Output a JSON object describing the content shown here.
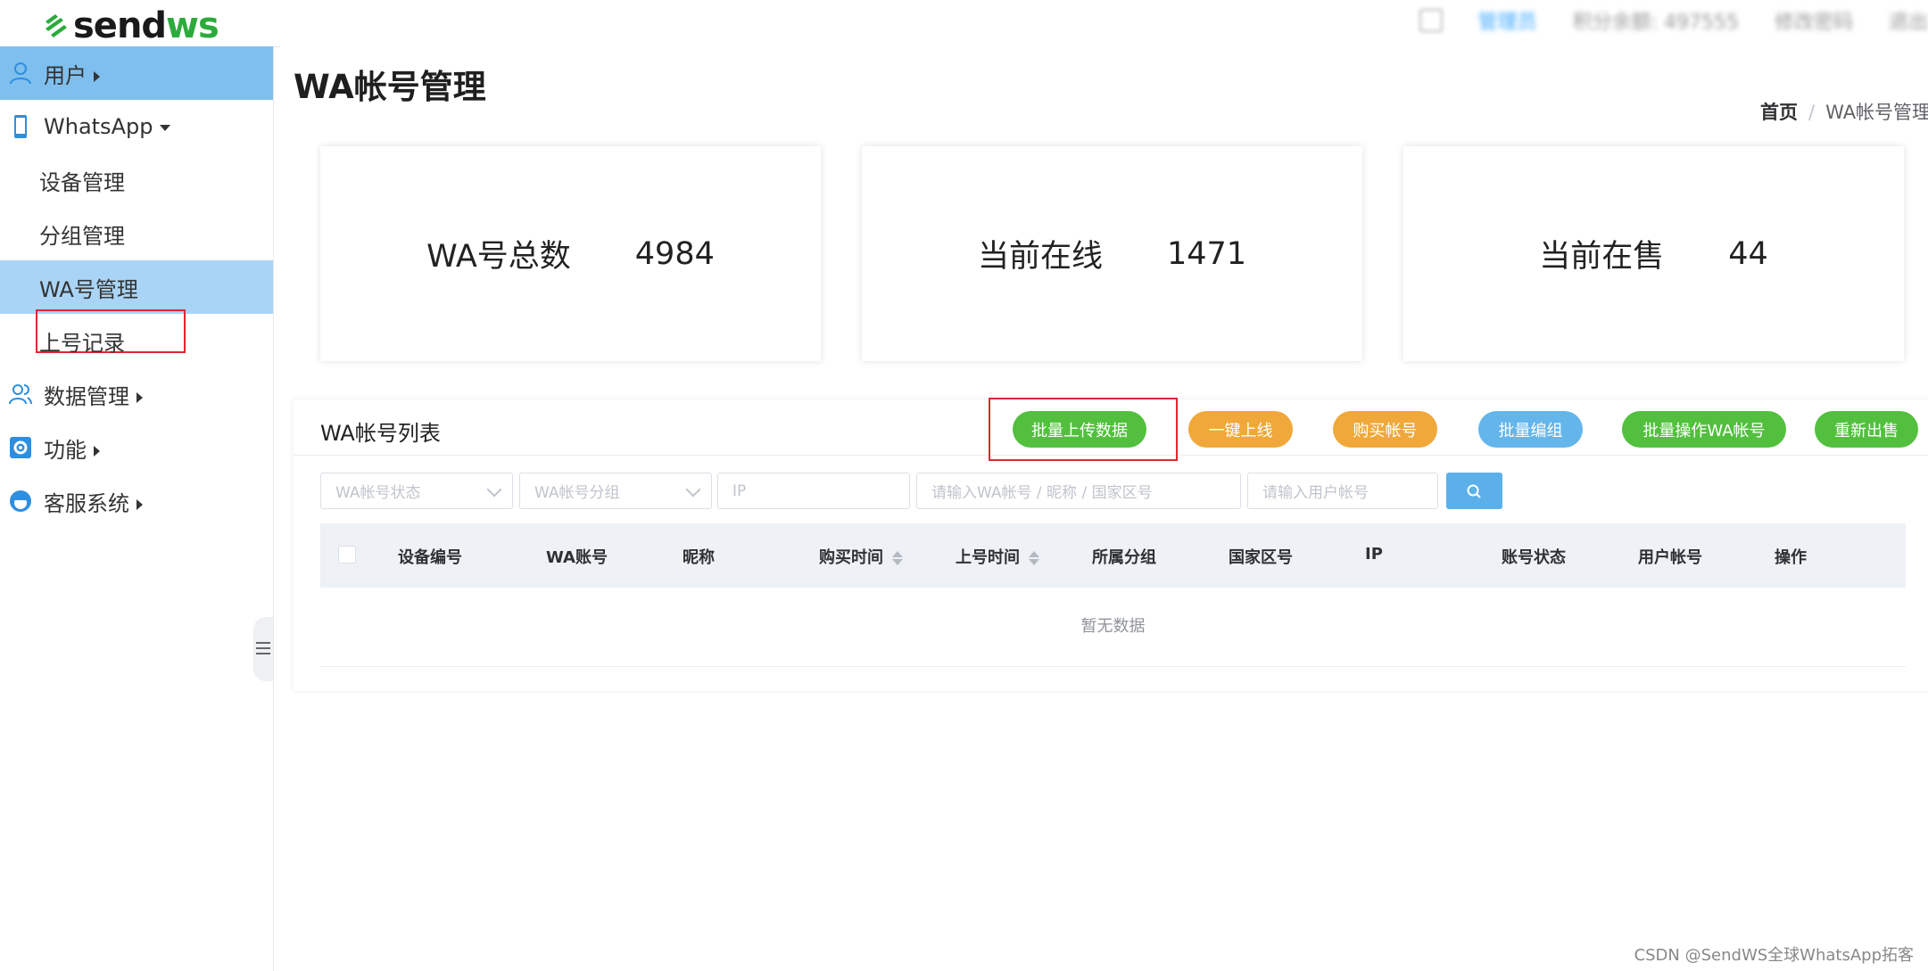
{
  "brand": {
    "name_part1": "send",
    "name_part2": "ws",
    "green": "#2cab3c"
  },
  "topbar": {
    "items": [
      "管理员",
      "积分余额: 497555",
      "修改密码",
      "退出"
    ]
  },
  "sidebar": {
    "items": [
      {
        "label": "用户",
        "icon": "user-icon"
      },
      {
        "label": "WhatsApp",
        "icon": "phone-icon"
      },
      {
        "label": "设备管理"
      },
      {
        "label": "分组管理"
      },
      {
        "label": "WA号管理",
        "selected": true
      },
      {
        "label": "上号记录"
      },
      {
        "label": "数据管理",
        "icon": "users-icon"
      },
      {
        "label": "功能",
        "icon": "gear-icon"
      },
      {
        "label": "客服系统",
        "icon": "support-icon"
      }
    ]
  },
  "page": {
    "title": "WA帐号管理"
  },
  "breadcrumb": {
    "home": "首页",
    "separator": "/",
    "current": "WA帐号管理"
  },
  "stats": [
    {
      "label": "WA号总数",
      "value": "4984"
    },
    {
      "label": "当前在线",
      "value": "1471"
    },
    {
      "label": "当前在售",
      "value": "44"
    }
  ],
  "list": {
    "title": "WA帐号列表",
    "buttons": {
      "batch_upload": "批量上传数据",
      "one_click_online": "一键上线",
      "buy_account": "购买帐号",
      "batch_edit_group": "批量编组",
      "batch_operate": "批量操作WA帐号",
      "resell": "重新出售"
    },
    "filters": {
      "status_placeholder": "WA帐号状态",
      "group_placeholder": "WA帐号分组",
      "ip_placeholder": "IP",
      "keyword_placeholder": "请输入WA帐号 / 昵称 / 国家区号",
      "user_placeholder": "请输入用户帐号"
    },
    "columns": [
      "设备编号",
      "WA账号",
      "昵称",
      "购买时间",
      "上号时间",
      "所属分组",
      "国家区号",
      "IP",
      "账号状态",
      "用户帐号",
      "操作"
    ],
    "empty_text": "暂无数据"
  },
  "watermark": "CSDN @SendWS全球WhatsApp拓客"
}
